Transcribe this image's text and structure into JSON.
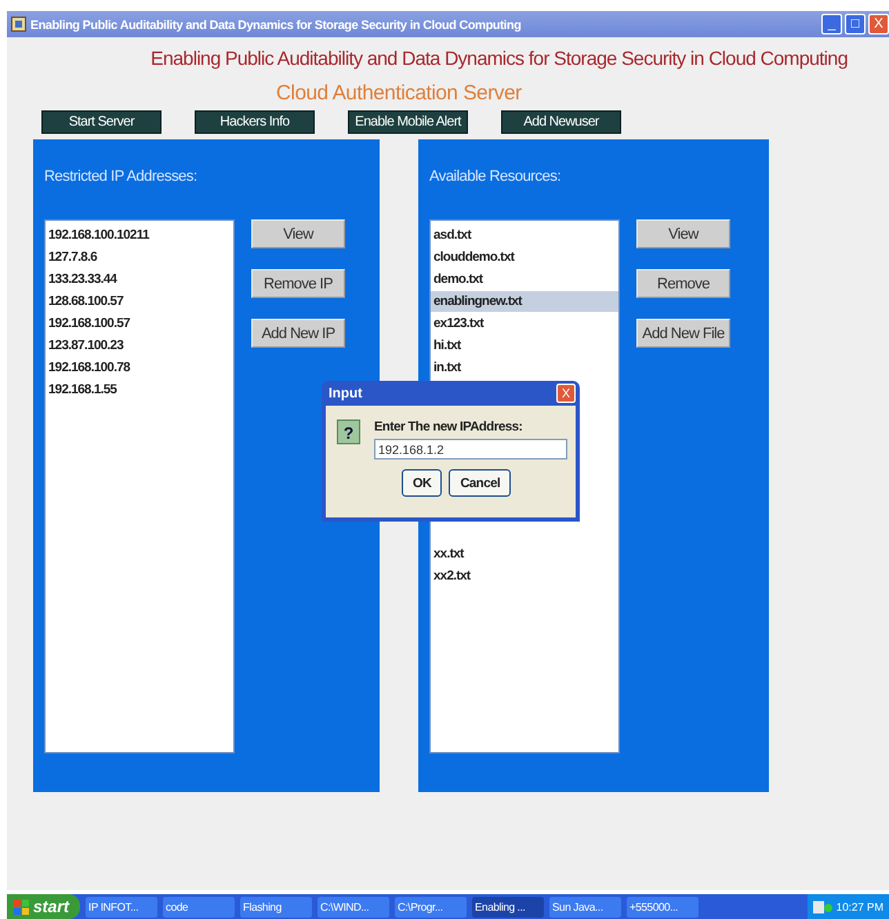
{
  "window": {
    "title": "Enabling Public Auditability and Data Dynamics for Storage Security in Cloud Computing",
    "controls": [
      "_",
      "□",
      "X"
    ]
  },
  "heading": "Enabling Public Auditability and Data Dynamics for Storage Security in Cloud Computing",
  "subheading": "Cloud Authentication Server",
  "toolbar": [
    "Start Server",
    "Hackers Info",
    "Enable Mobile Alert",
    "Add Newuser"
  ],
  "panels": [
    {
      "title": "Restricted IP Addresses:",
      "items": [
        {
          "text": "192.168.100.10211",
          "selected": false
        },
        {
          "text": "127.7.8.6",
          "selected": false
        },
        {
          "text": "133.23.33.44",
          "selected": false
        },
        {
          "text": "128.68.100.57",
          "selected": false
        },
        {
          "text": "192.168.100.57",
          "selected": false
        },
        {
          "text": "123.87.100.23",
          "selected": false
        },
        {
          "text": "192.168.100.78",
          "selected": false
        },
        {
          "text": "192.168.1.55",
          "selected": false
        }
      ],
      "buttons": [
        "View",
        "Remove IP",
        "Add New IP"
      ]
    },
    {
      "title": "Available Resources:",
      "items": [
        {
          "text": "asd.txt",
          "selected": false
        },
        {
          "text": "clouddemo.txt",
          "selected": false
        },
        {
          "text": "demo.txt",
          "selected": false
        },
        {
          "text": "enablingnew.txt",
          "selected": true
        },
        {
          "text": "ex123.txt",
          "selected": false
        },
        {
          "text": "hi.txt",
          "selected": false
        },
        {
          "text": "in.txt",
          "selected": false
        },
        {
          "text": "xx.txt",
          "selected": false
        },
        {
          "text": "xx2.txt",
          "selected": false
        }
      ],
      "buttons": [
        "View",
        "Remove",
        "Add New File"
      ]
    }
  ],
  "dialog": {
    "title": "Input",
    "close": "X",
    "icon": "?",
    "prompt": "Enter The new IPAddress:",
    "value": "192.168.1.2",
    "buttons": [
      "OK",
      "Cancel"
    ]
  },
  "taskbar": {
    "start": "start",
    "items": [
      {
        "label": "IP INFOT...",
        "selected": false
      },
      {
        "label": "code",
        "selected": false
      },
      {
        "label": "Flashing",
        "selected": false
      },
      {
        "label": "C:\\WIND...",
        "selected": false
      },
      {
        "label": "C:\\Progr...",
        "selected": false
      },
      {
        "label": "Enabling ...",
        "selected": true
      },
      {
        "label": "Sun Java...",
        "selected": false
      },
      {
        "label": "+555000...",
        "selected": false
      }
    ],
    "clock": "10:27 PM"
  }
}
